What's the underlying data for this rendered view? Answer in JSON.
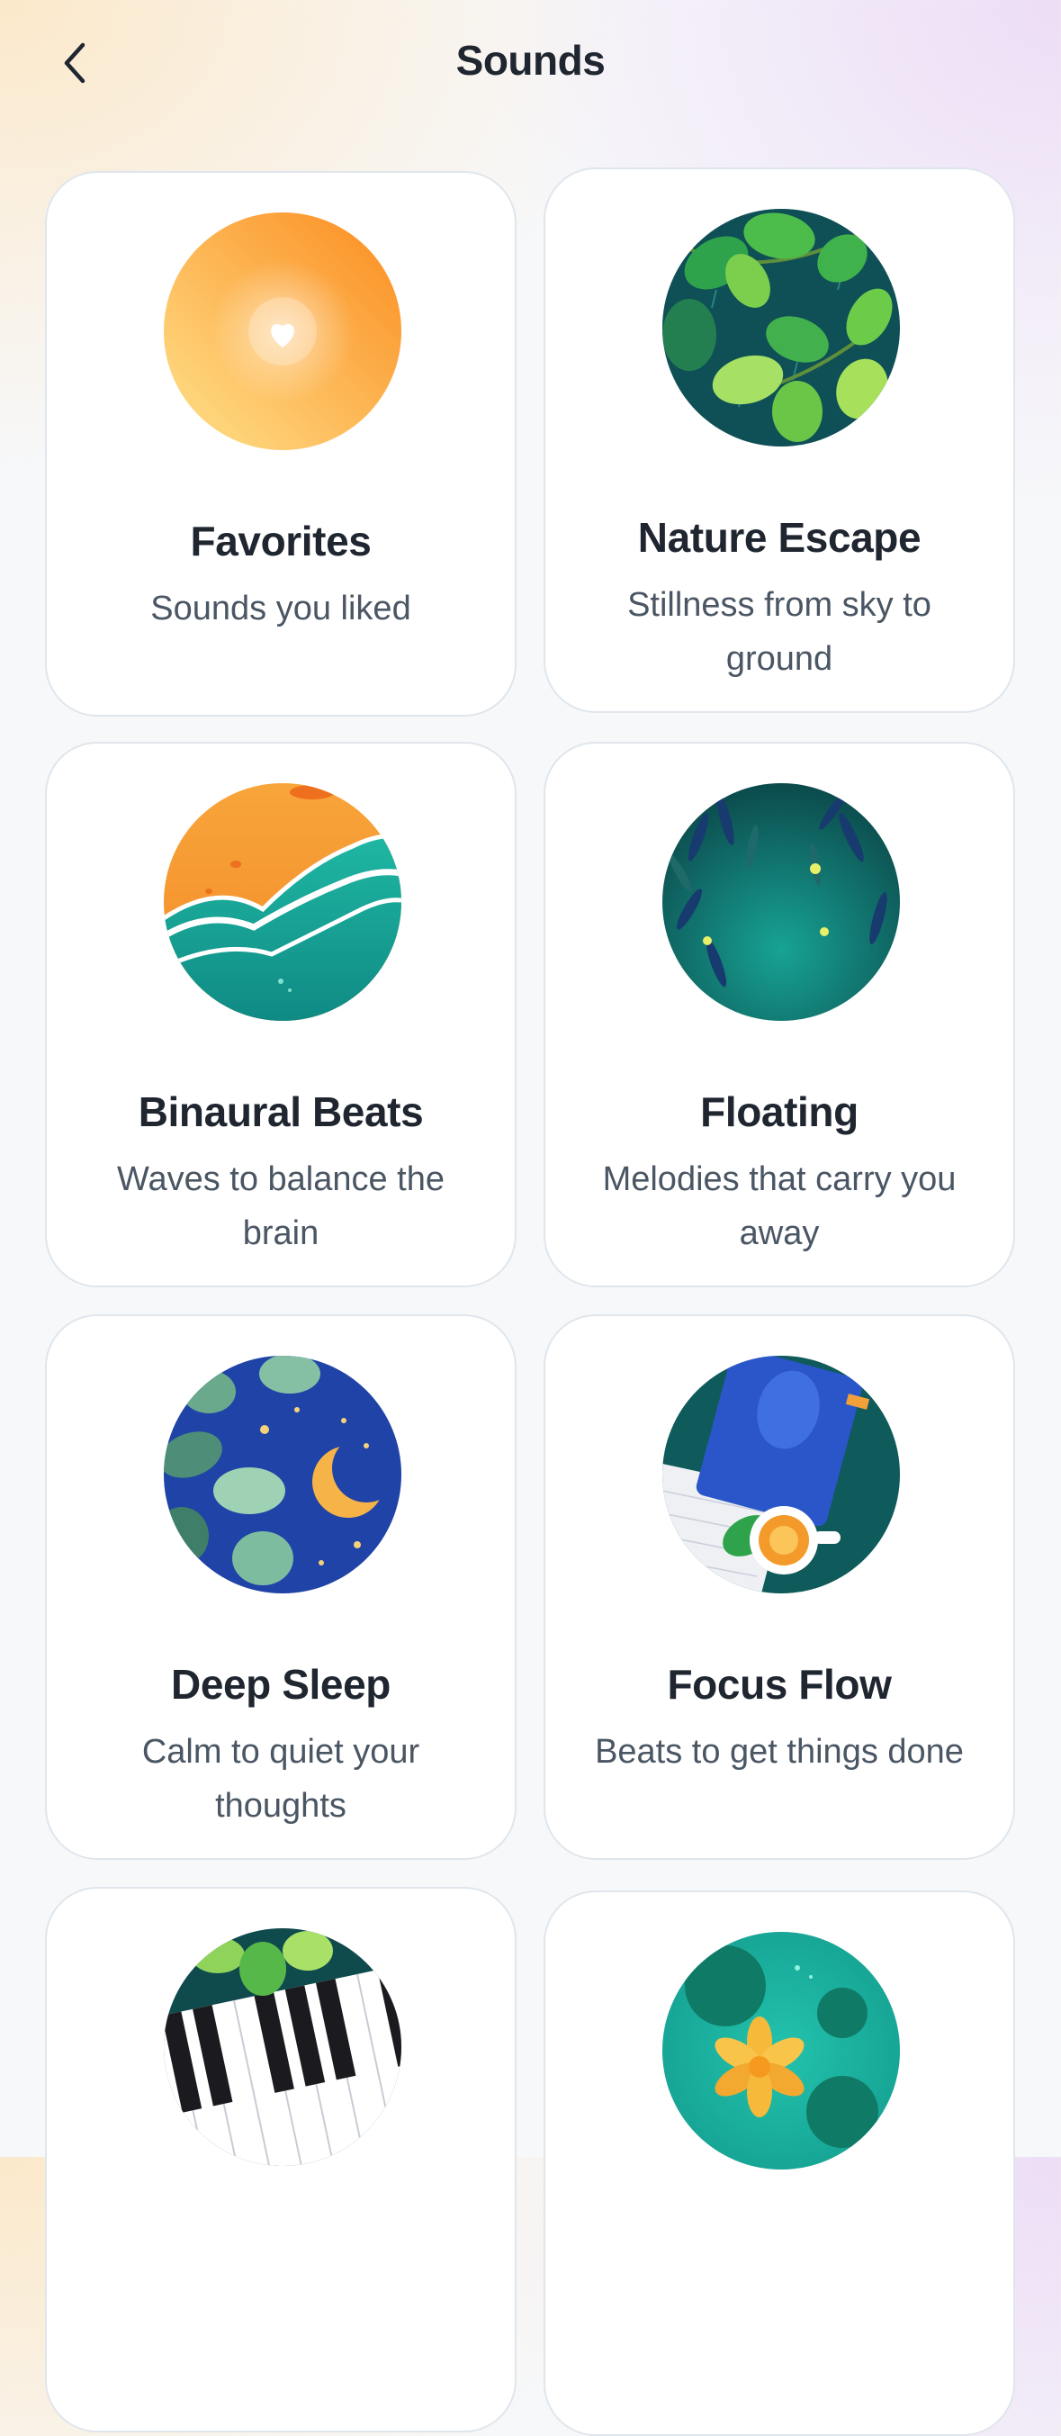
{
  "header": {
    "title": "Sounds",
    "back_icon": "chevron-left-icon"
  },
  "cards": [
    {
      "title": "Favorites",
      "subtitle": "Sounds you liked",
      "art": "heart-orb-art"
    },
    {
      "title": "Nature Escape",
      "subtitle": "Stillness from sky to ground",
      "art": "leaves-art"
    },
    {
      "title": "Binaural Beats",
      "subtitle": "Waves to balance the brain",
      "art": "waves-art"
    },
    {
      "title": "Floating",
      "subtitle": "Melodies that carry you away",
      "art": "willow-fireflies-art"
    },
    {
      "title": "Deep Sleep",
      "subtitle": "Calm to quiet your thoughts",
      "art": "moon-leaves-art"
    },
    {
      "title": "Focus Flow",
      "subtitle": "Beats to get things done",
      "art": "book-tea-art"
    },
    {
      "title": "",
      "subtitle": "",
      "art": "piano-art"
    },
    {
      "title": "",
      "subtitle": "",
      "art": "lotus-pond-art"
    }
  ],
  "colors": {
    "text": "#1f2630",
    "subtext": "#4a5663",
    "card_border": "#dfe6ec"
  }
}
